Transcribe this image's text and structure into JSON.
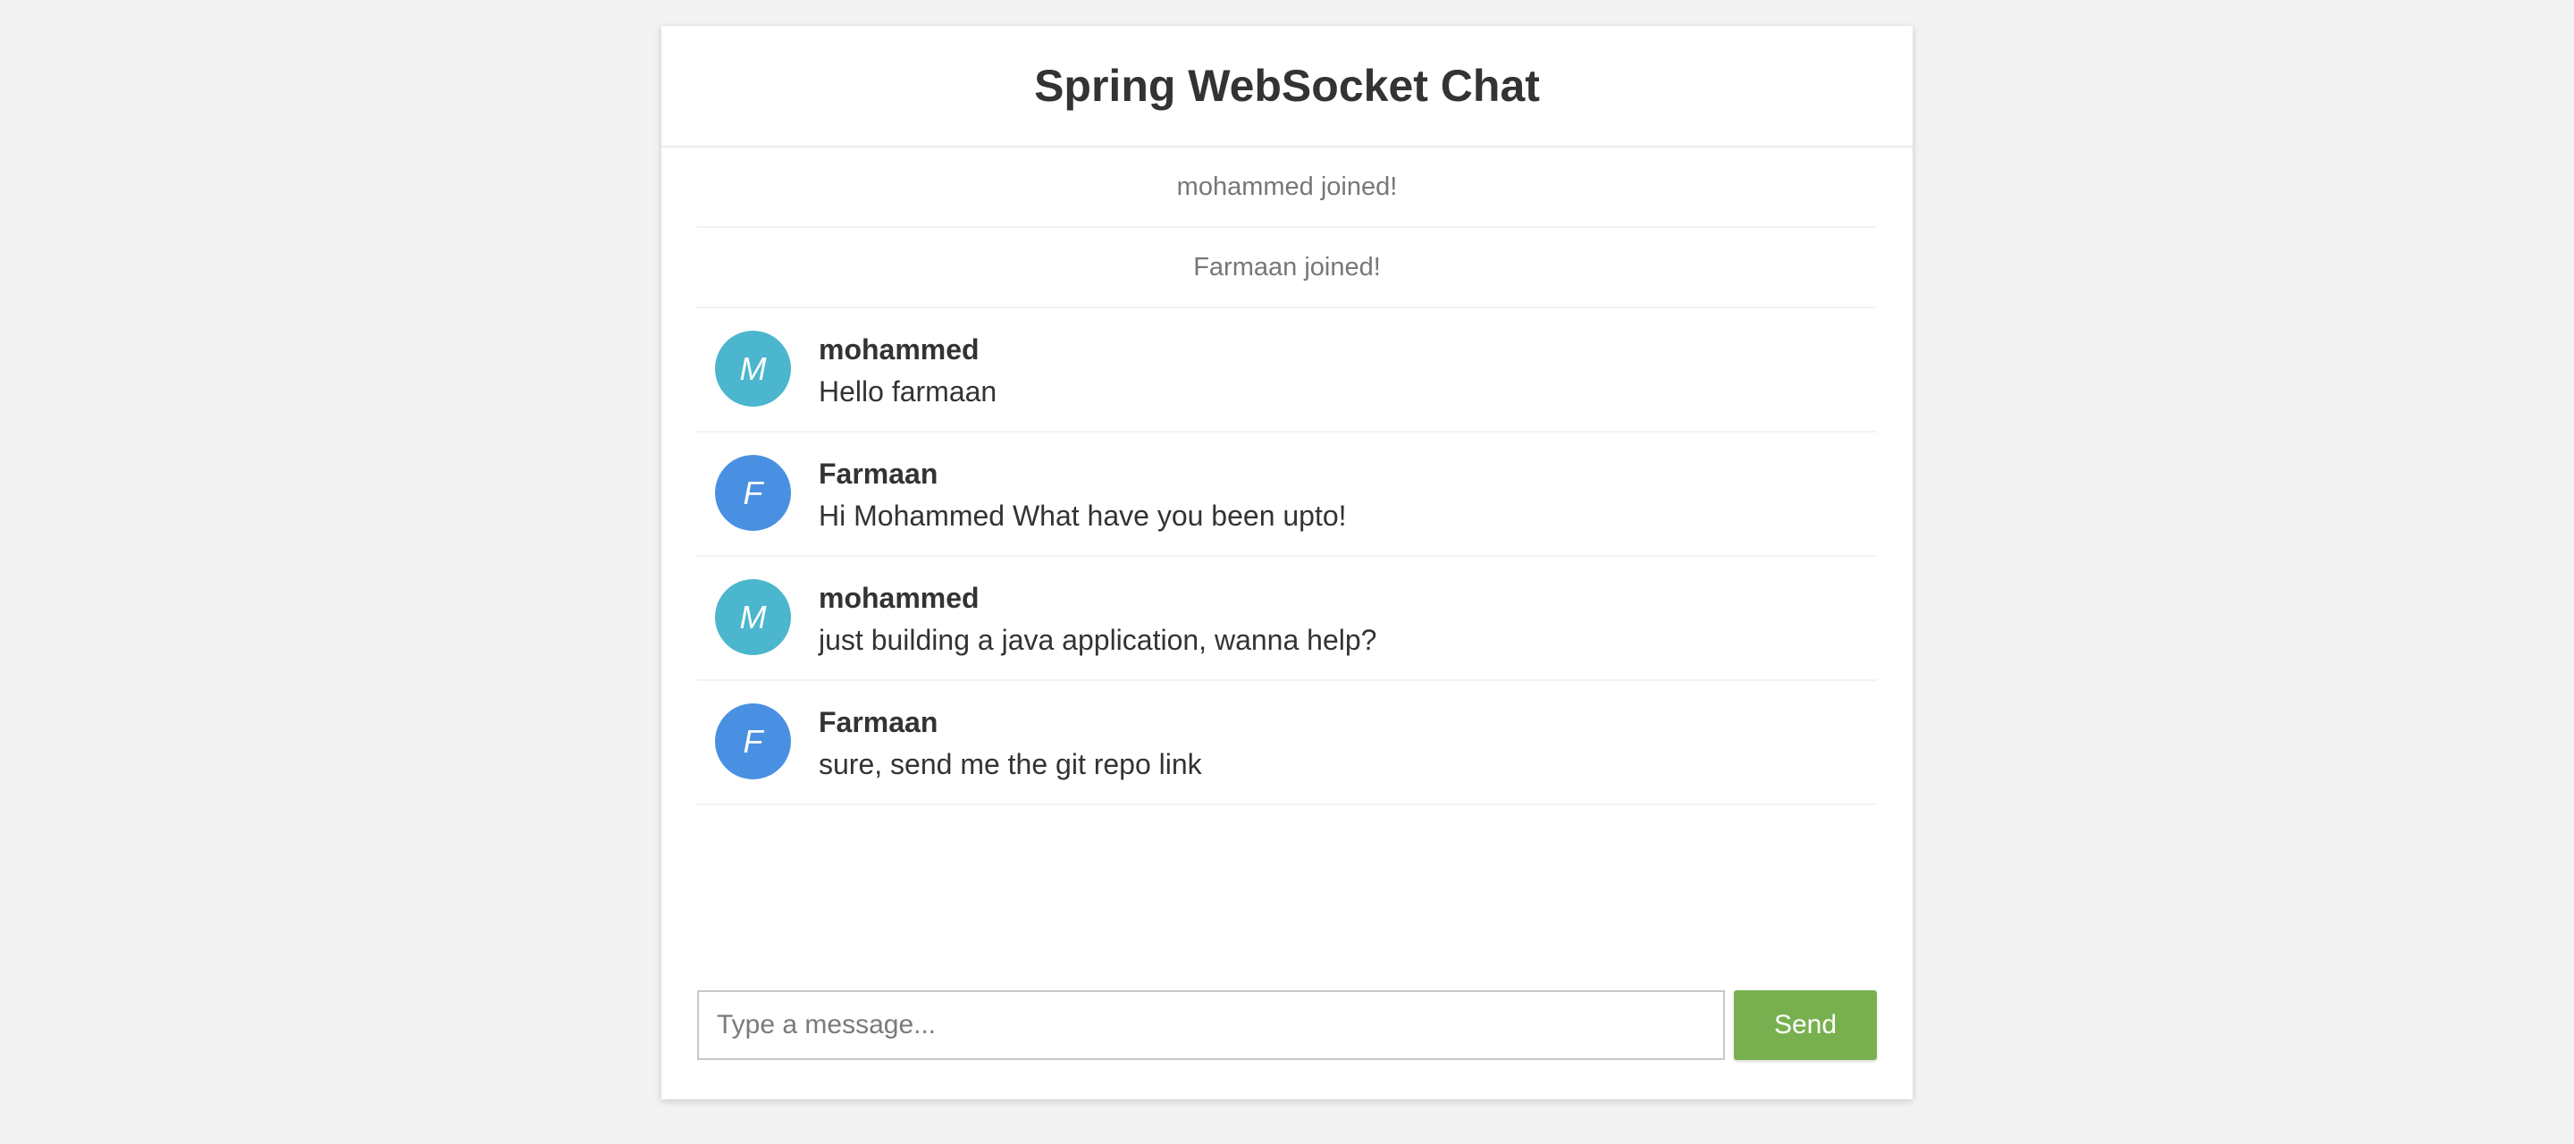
{
  "header": {
    "title": "Spring WebSocket Chat"
  },
  "events": [
    {
      "text": "mohammed joined!"
    },
    {
      "text": "Farmaan joined!"
    }
  ],
  "messages": [
    {
      "initial": "M",
      "sender": "mohammed",
      "text": "Hello farmaan",
      "avatar_color": "#4bb6cd"
    },
    {
      "initial": "F",
      "sender": "Farmaan",
      "text": "Hi Mohammed What have you been upto!",
      "avatar_color": "#4a90e2"
    },
    {
      "initial": "M",
      "sender": "mohammed",
      "text": "just building a java application, wanna help?",
      "avatar_color": "#4bb6cd"
    },
    {
      "initial": "F",
      "sender": "Farmaan",
      "text": "sure, send me the git repo link",
      "avatar_color": "#4a90e2"
    }
  ],
  "input": {
    "placeholder": "Type a message...",
    "value": ""
  },
  "send_button": {
    "label": "Send",
    "color": "#78b04f"
  },
  "colors": {
    "page_background": "#f3f3f3",
    "panel_background": "#ffffff"
  }
}
